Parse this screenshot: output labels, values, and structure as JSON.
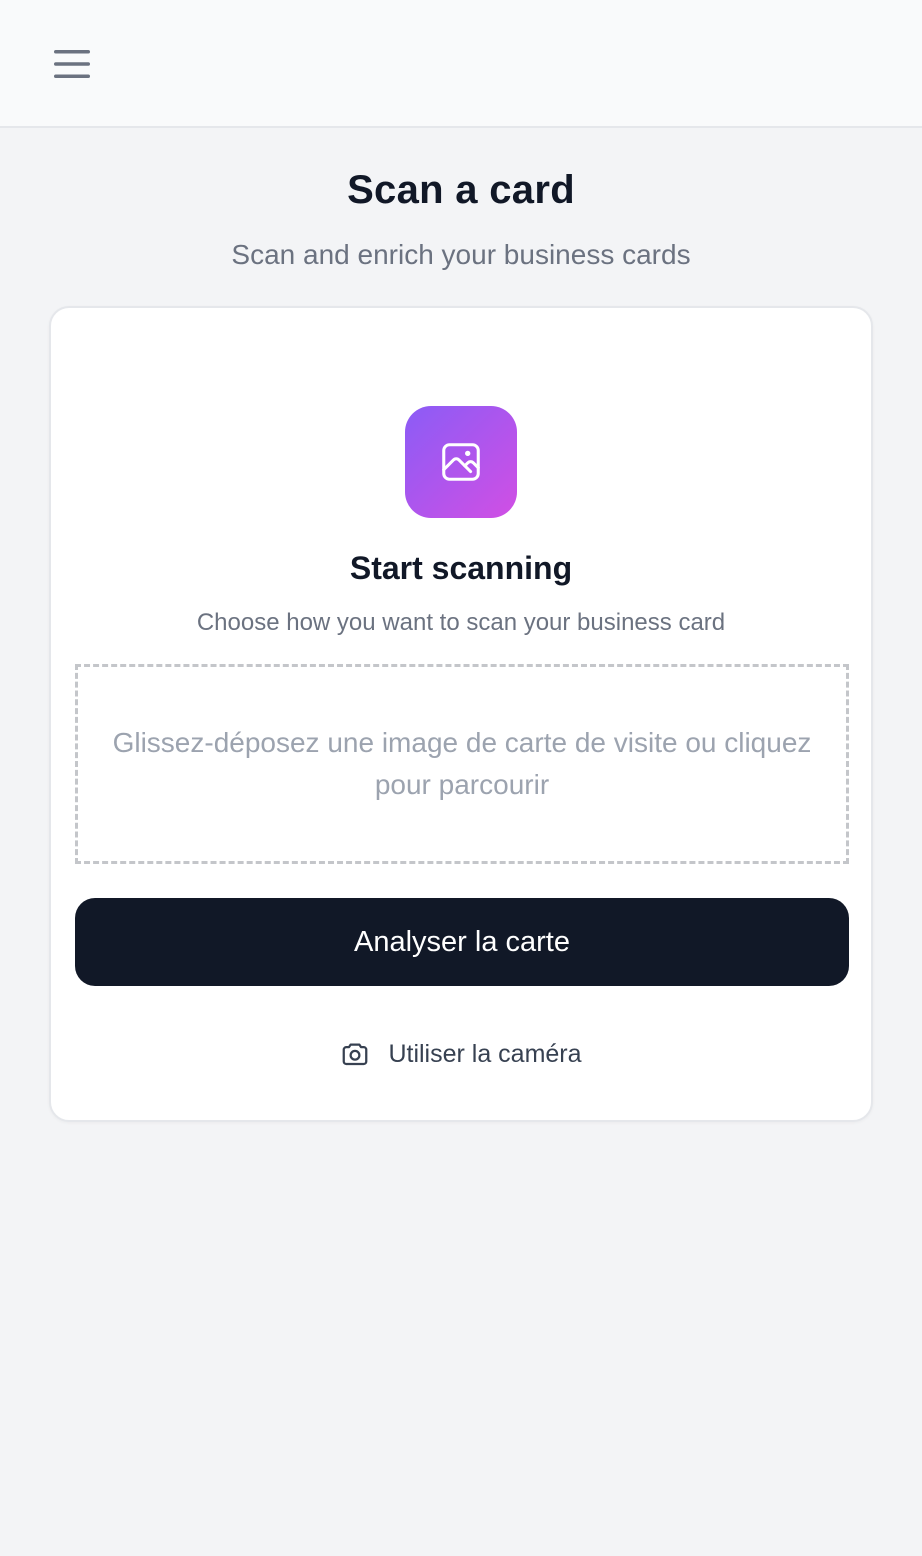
{
  "header": {
    "menu_icon": "hamburger-menu-icon"
  },
  "page": {
    "title": "Scan a card",
    "subtitle": "Scan and enrich your business cards"
  },
  "scan_card": {
    "icon": "image-icon",
    "accent_gradient": [
      "#8b5cf6",
      "#d14fe4"
    ],
    "title": "Start scanning",
    "subtitle": "Choose how you want to scan your business card",
    "dropzone_text": "Glissez-déposez une image de carte de visite ou cliquez pour parcourir",
    "analyze_label": "Analyser la carte",
    "camera_icon": "camera-icon",
    "camera_label": "Utiliser la caméra"
  },
  "colors": {
    "primary_button": "#111827",
    "background": "#f3f4f6"
  }
}
